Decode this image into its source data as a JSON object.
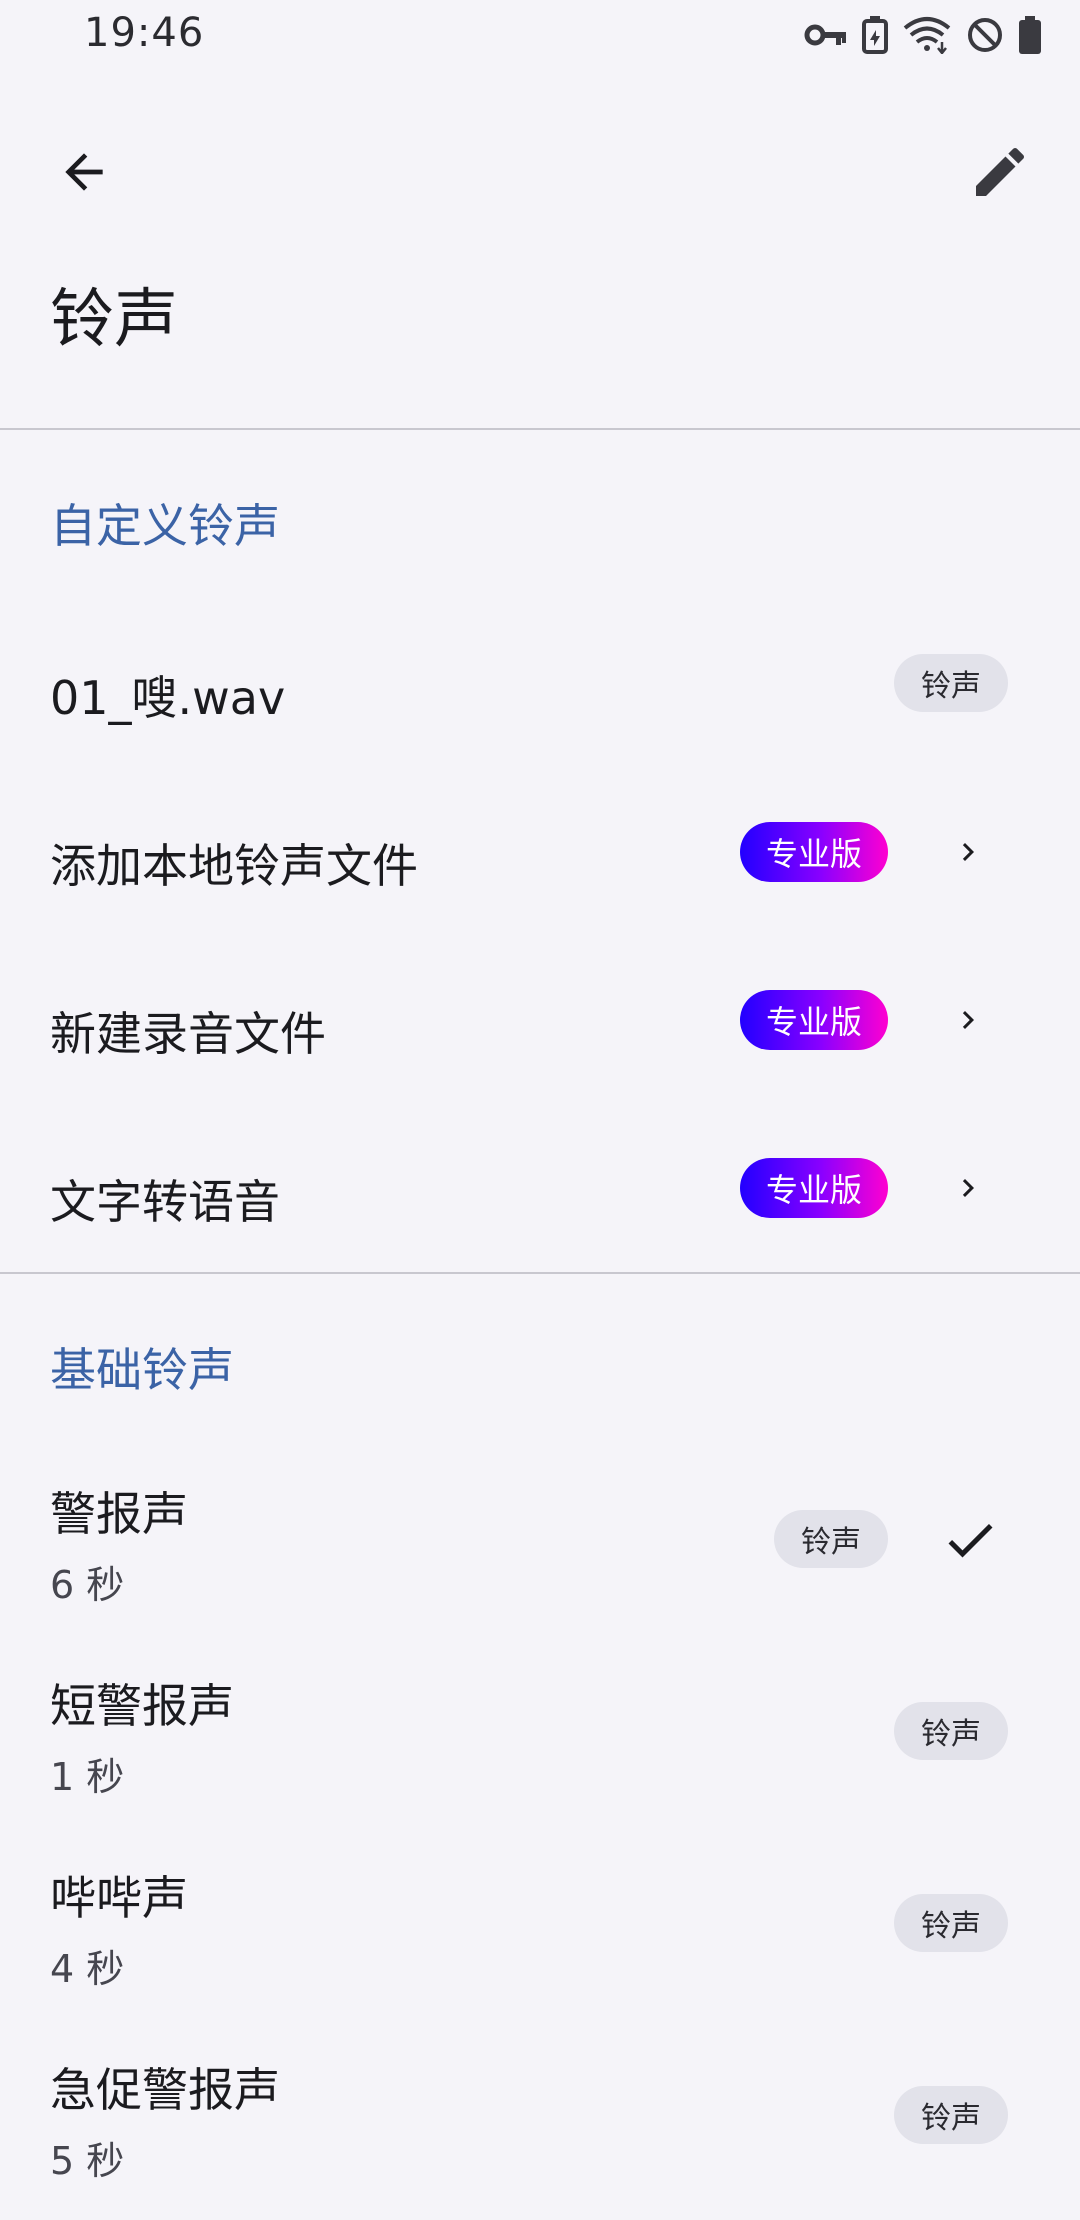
{
  "status_bar": {
    "time": "19:46",
    "icons": [
      "vpn-key-icon",
      "battery-saver-icon",
      "wifi-icon",
      "do-not-disturb-icon",
      "battery-icon"
    ]
  },
  "app_bar": {
    "back_icon": "arrow-back-icon",
    "edit_icon": "pencil-icon"
  },
  "page": {
    "title": "铃声"
  },
  "custom_section": {
    "header": "自定义铃声",
    "items": [
      {
        "label": "01_嗖.wav",
        "chip": "铃声"
      },
      {
        "label": "添加本地铃声文件",
        "badge": "专业版"
      },
      {
        "label": "新建录音文件",
        "badge": "专业版"
      },
      {
        "label": "文字转语音",
        "badge": "专业版"
      }
    ]
  },
  "basic_section": {
    "header": "基础铃声",
    "items": [
      {
        "label": "警报声",
        "duration": "6 秒",
        "chip": "铃声",
        "selected": true
      },
      {
        "label": "短警报声",
        "duration": "1 秒",
        "chip": "铃声",
        "selected": false
      },
      {
        "label": "哔哔声",
        "duration": "4 秒",
        "chip": "铃声",
        "selected": false
      },
      {
        "label": "急促警报声",
        "duration": "5 秒",
        "chip": "铃声",
        "selected": false
      }
    ]
  },
  "colors": {
    "section_header": "#3b63a6",
    "background": "#f5f4f9",
    "pro_gradient": [
      "#2200ff",
      "#ff00d0"
    ]
  }
}
